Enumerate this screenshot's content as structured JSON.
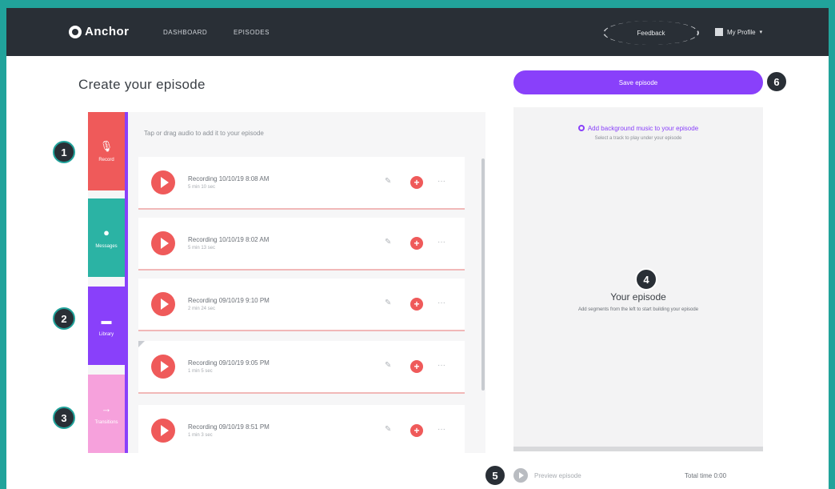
{
  "nav": {
    "logo_text": "Anchor",
    "links": [
      "DASHBOARD",
      "EPISODES"
    ],
    "feedback_label": "Feedback",
    "account_label": "My Profile",
    "account_chevron": "▾"
  },
  "page": {
    "title": "Create your episode"
  },
  "tools": {
    "hint": "Tap or drag audio to add it to your episode",
    "tabs": [
      {
        "name": "record",
        "label": "Record",
        "glyph": "🎙",
        "color": "#ef5a5a"
      },
      {
        "name": "messages",
        "label": "Messages",
        "glyph": "●",
        "color": "#2bb3a4"
      },
      {
        "name": "library",
        "label": "Library",
        "glyph": "▬",
        "color": "#8940fa"
      },
      {
        "name": "transitions",
        "label": "Transitions",
        "glyph": "→",
        "color": "#f6a1dc"
      }
    ]
  },
  "recordings": [
    {
      "title": "Recording 10/10/19 8:08 AM",
      "duration": "5 min 10 sec"
    },
    {
      "title": "Recording 10/10/19 8:02 AM",
      "duration": "5 min 13 sec"
    },
    {
      "title": "Recording 09/10/19 9:10 PM",
      "duration": "2 min 24 sec"
    },
    {
      "title": "Recording 09/10/19 9:05 PM",
      "duration": "1 min 5 sec"
    },
    {
      "title": "Recording 09/10/19 8:51 PM",
      "duration": "1 min 3 sec"
    }
  ],
  "row_actions": {
    "edit_glyph": "✎",
    "add_glyph": "+",
    "more_glyph": "···"
  },
  "episode": {
    "save_label": "Save episode",
    "link_label": "Add background music to your episode",
    "note": "Select a track to play under your episode",
    "panel_title": "Your episode",
    "panel_desc": "Add segments from the left to start building your episode"
  },
  "footer": {
    "preview_label": "Preview episode",
    "total_time": "Total time 0:00"
  },
  "badges": [
    "1",
    "2",
    "3",
    "4",
    "5",
    "6"
  ]
}
